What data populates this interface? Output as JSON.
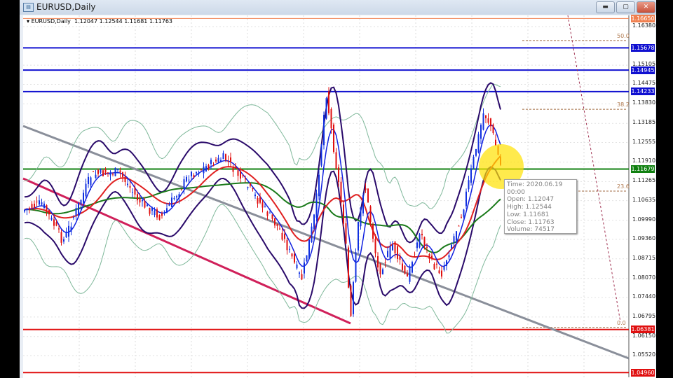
{
  "window": {
    "title": "EURUSD,Daily",
    "buttons": [
      "minimize",
      "maximize",
      "close"
    ]
  },
  "chart_header": {
    "symbol": "EURUSD,Daily",
    "open": "1.12047",
    "high": "1.12544",
    "low": "1.11681",
    "close": "1.11763"
  },
  "price_axis": [
    "1.16380",
    "1.15105",
    "1.14475",
    "1.13830",
    "1.13185",
    "1.12555",
    "1.11910",
    "1.11265",
    "1.10635",
    "1.09990",
    "1.09360",
    "1.08715",
    "1.08070",
    "1.07440",
    "1.06795",
    "1.06150",
    "1.05520"
  ],
  "levels": [
    {
      "price": "1.16650",
      "color": "#f08050"
    },
    {
      "price": "1.15678",
      "color": "#1010d0"
    },
    {
      "price": "1.14945",
      "color": "#1010d0"
    },
    {
      "price": "1.14233",
      "color": "#1010d0"
    },
    {
      "price": "1.11679",
      "color": "#108010"
    },
    {
      "price": "1.06381",
      "color": "#e01010"
    },
    {
      "price": "1.04960",
      "color": "#e01010"
    }
  ],
  "fib_levels": [
    {
      "label": "50.0",
      "price": 1.1592
    },
    {
      "label": "38.2",
      "price": 1.1365
    },
    {
      "label": "23.6",
      "price": 1.1095
    },
    {
      "label": "0.0",
      "price": 1.0645
    }
  ],
  "tooltip": {
    "time": "Time: 2020.06.19 00:00",
    "open": "Open: 1.12047",
    "high": "High: 1.12544",
    "low": "Low:  1.11681",
    "close": "Close: 1.11763",
    "volume": "Volume: 74517"
  }
}
